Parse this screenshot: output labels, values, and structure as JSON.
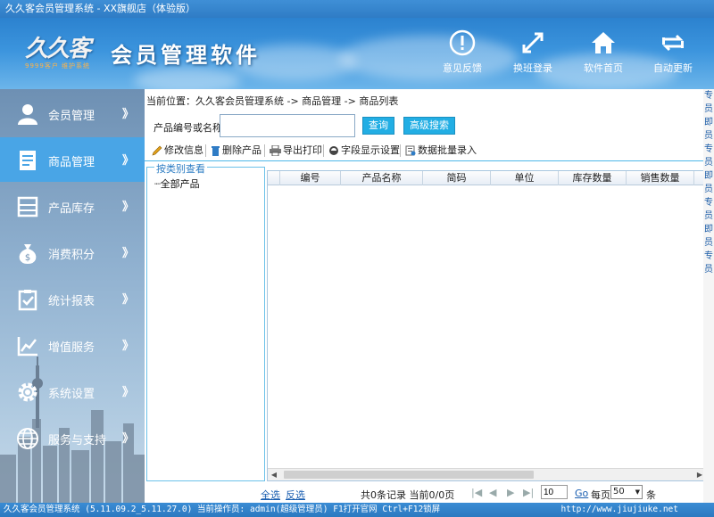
{
  "window": {
    "title": "久久客会员管理系统 - XX旗舰店（体验版）"
  },
  "header": {
    "logo_mark": "久久客",
    "logo_sub": "9999客户 维护系统",
    "app_title": "会员管理软件",
    "buttons": [
      {
        "label": "意见反馈",
        "icon": "feedback-icon"
      },
      {
        "label": "换班登录",
        "icon": "switch-login-icon"
      },
      {
        "label": "软件首页",
        "icon": "home-icon"
      },
      {
        "label": "自动更新",
        "icon": "update-icon"
      }
    ]
  },
  "sidebar": {
    "items": [
      {
        "label": "会员管理",
        "icon": "member-icon",
        "active": false
      },
      {
        "label": "商品管理",
        "icon": "product-icon",
        "active": true
      },
      {
        "label": "产品库存",
        "icon": "inventory-icon",
        "active": false
      },
      {
        "label": "消费积分",
        "icon": "points-icon",
        "active": false
      },
      {
        "label": "统计报表",
        "icon": "report-icon",
        "active": false
      },
      {
        "label": "增值服务",
        "icon": "value-added-icon",
        "active": false
      },
      {
        "label": "系统设置",
        "icon": "settings-icon",
        "active": false
      },
      {
        "label": "服务与支持",
        "icon": "globe-icon",
        "active": false
      }
    ],
    "chevron": "》"
  },
  "main": {
    "breadcrumb": "当前位置：久久客会员管理系统 -> 商品管理 -> 商品列表",
    "search": {
      "label": "产品编号或名称:",
      "value": "",
      "placeholder": "",
      "query_button": "查询",
      "advanced_button": "高级搜索"
    },
    "toolbar": {
      "edit": "修改信息",
      "delete": "删除产品",
      "export": "导出打印",
      "fields": "字段显示设置",
      "batch": "数据批量录入"
    },
    "tree": {
      "legend": "按类别查看",
      "root": "全部产品"
    },
    "grid": {
      "columns": [
        "编号",
        "产品名称",
        "简码",
        "单位",
        "库存数量",
        "销售数量"
      ],
      "rows": []
    },
    "pager": {
      "select_all": "全选",
      "invert": "反选",
      "summary": "共0条记录 当前0/0页",
      "first": "|◀",
      "prev": "◀",
      "next": "▶",
      "last": "▶|",
      "page_input": "10",
      "go": "Go",
      "per_page_label": "每页",
      "per_page_value": "50",
      "per_page_unit": "条"
    }
  },
  "statusbar": {
    "text": "久久客会员管理系统 (5.11.09.2_5.11.27.0)  当前操作员: admin(超级管理员)  F1打开官网 Ctrl+F12锁屏",
    "url": "http://www.jiujiuke.net"
  },
  "right_strip": [
    "专",
    "员",
    "即",
    "员",
    "专",
    "员",
    "即",
    "员",
    "专",
    "员",
    "即",
    "员",
    "专",
    "员"
  ],
  "colors": {
    "accent": "#49a5e6",
    "button": "#22aee4",
    "titlebar": "#3f8fd6"
  }
}
